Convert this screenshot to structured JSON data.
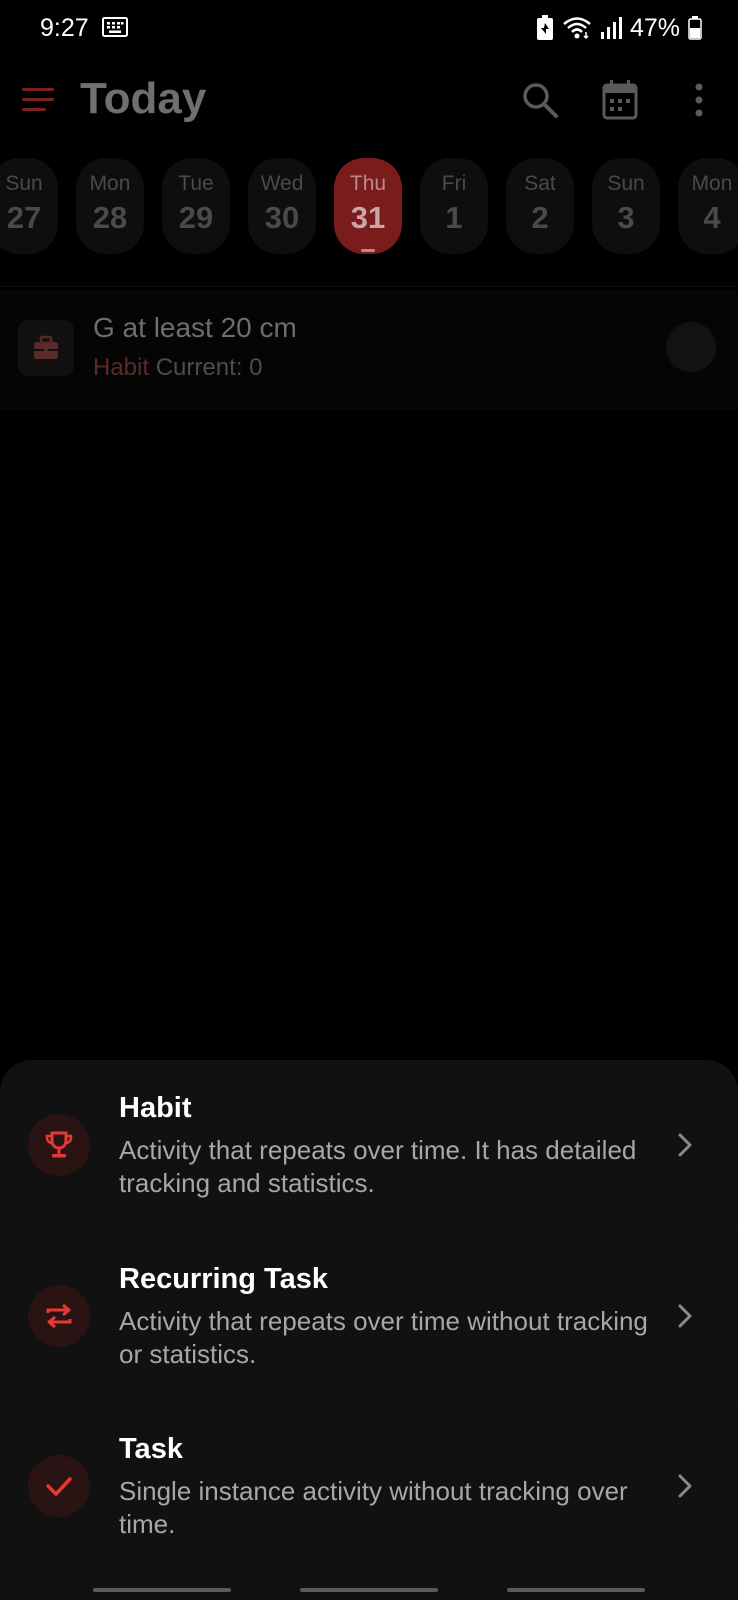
{
  "status_bar": {
    "time": "9:27",
    "battery": "47%"
  },
  "app_bar": {
    "title": "Today"
  },
  "date_strip": {
    "days": [
      {
        "name": "Sun",
        "num": "27"
      },
      {
        "name": "Mon",
        "num": "28"
      },
      {
        "name": "Tue",
        "num": "29"
      },
      {
        "name": "Wed",
        "num": "30"
      },
      {
        "name": "Thu",
        "num": "31"
      },
      {
        "name": "Fri",
        "num": "1"
      },
      {
        "name": "Sat",
        "num": "2"
      },
      {
        "name": "Sun",
        "num": "3"
      },
      {
        "name": "Mon",
        "num": "4"
      }
    ],
    "selected_index": 4
  },
  "task": {
    "title": "G at least 20 cm",
    "type": "Habit",
    "status": "Current: 0"
  },
  "sheet": {
    "options": [
      {
        "title": "Habit",
        "description": "Activity that repeats over time. It has detailed tracking and statistics.",
        "icon": "trophy-icon"
      },
      {
        "title": "Recurring Task",
        "description": "Activity that repeats over time without tracking or statistics.",
        "icon": "repeat-icon"
      },
      {
        "title": "Task",
        "description": "Single instance activity without tracking over time.",
        "icon": "check-icon"
      }
    ]
  },
  "colors": {
    "accent": "#e53935",
    "background": "#000000",
    "sheet": "#111111",
    "selected_day": "#7a1c1c"
  }
}
